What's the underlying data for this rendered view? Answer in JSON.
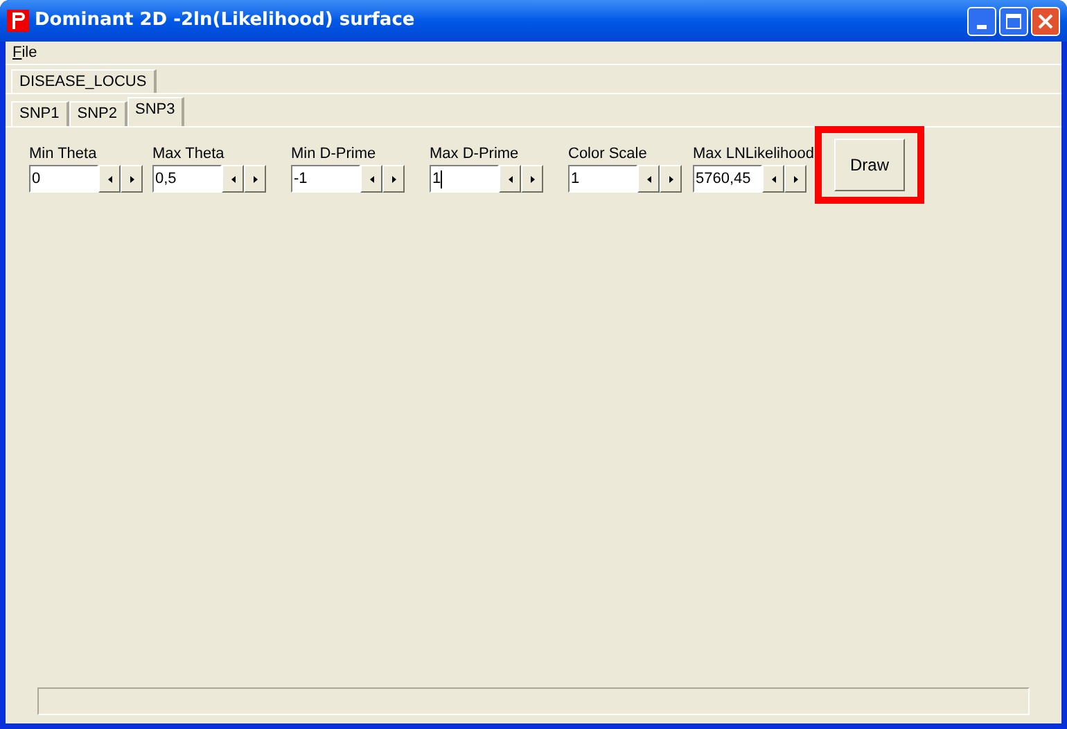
{
  "window": {
    "title": "Dominant 2D -2ln(Likelihood) surface"
  },
  "menu": [
    {
      "label": "File"
    }
  ],
  "outer_tabs": [
    {
      "label": "DISEASE_LOCUS",
      "selected": true
    }
  ],
  "inner_tabs": [
    {
      "label": "SNP1",
      "selected": false
    },
    {
      "label": "SNP2",
      "selected": false
    },
    {
      "label": "SNP3",
      "selected": true
    }
  ],
  "fields": [
    {
      "label": "Min Theta",
      "value": "0",
      "focused": false
    },
    {
      "label": "Max Theta",
      "value": "0,5",
      "focused": false
    },
    {
      "label": "Min D-Prime",
      "value": "-1",
      "focused": false
    },
    {
      "label": "Max D-Prime",
      "value": "1",
      "focused": true
    },
    {
      "label": "Color Scale",
      "value": "1",
      "focused": false
    },
    {
      "label": "Max LNLikelihood",
      "value": "5760,45",
      "focused": false
    }
  ],
  "draw_button": {
    "label": "Draw",
    "highlighted": true
  }
}
